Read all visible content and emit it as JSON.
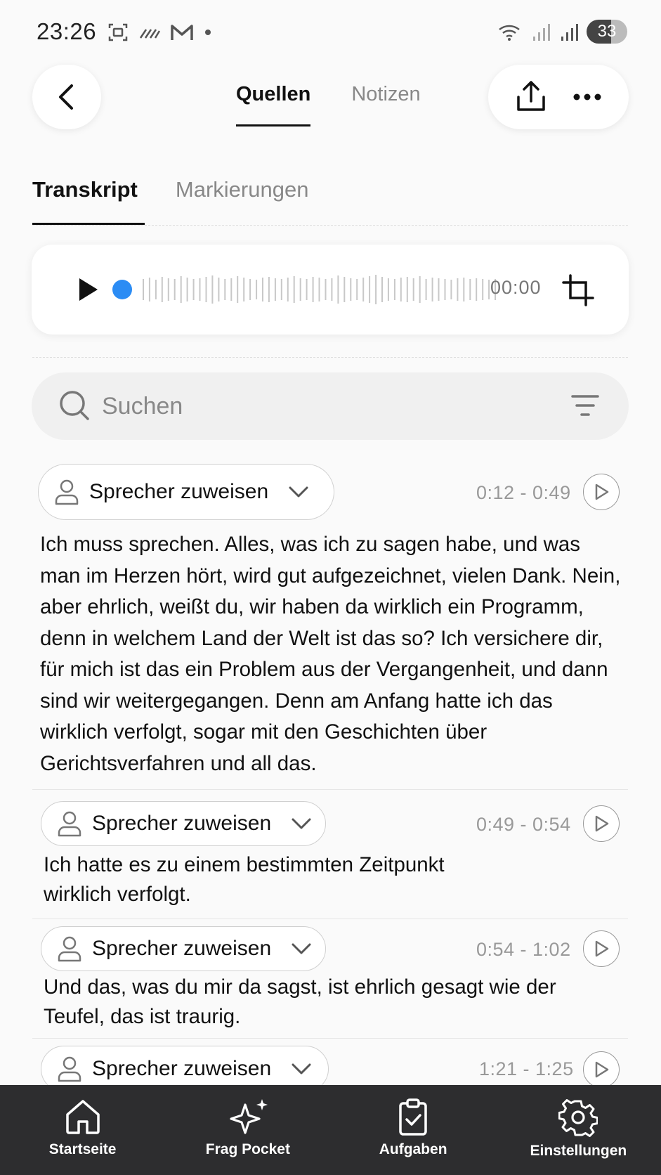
{
  "status_bar": {
    "time": "23:26",
    "battery": "33"
  },
  "header": {
    "tabs": [
      {
        "label": "Quellen",
        "active": true
      },
      {
        "label": "Notizen",
        "active": false
      }
    ],
    "back_icon": "chevron-left-icon",
    "share_icon": "share-icon",
    "more_icon": "more-horizontal-icon"
  },
  "sub_tabs": [
    {
      "label": "Transkript",
      "active": true
    },
    {
      "label": "Markierungen",
      "active": false
    }
  ],
  "player": {
    "time": "00:00",
    "progress": 0,
    "accent": "#2b8cf4"
  },
  "search": {
    "placeholder": "Suchen"
  },
  "segments": [
    {
      "speaker_label": "Sprecher zuweisen",
      "range": "0:12 - 0:49",
      "text": "Ich muss sprechen. Alles, was ich zu sagen habe, und was man im Herzen hört, wird gut aufgezeichnet, vielen Dank. Nein, aber ehrlich, weißt du, wir haben da wirklich ein Programm, denn in welchem Land der Welt ist das so? Ich versichere dir, für mich ist das ein Problem aus der Vergangenheit, und dann sind wir weitergegangen. Denn am Anfang hatte ich das wirklich verfolgt, sogar mit den Geschichten über Gerichtsverfahren und all das."
    },
    {
      "speaker_label": "Sprecher zuweisen",
      "range": "0:49 - 0:54",
      "text": "Ich hatte es zu einem bestimmten Zeitpunkt wirklich verfolgt."
    },
    {
      "speaker_label": "Sprecher zuweisen",
      "range": "0:54 - 1:02",
      "text": "Und das, was du mir da sagst, ist ehrlich gesagt wie der Teufel, das ist traurig."
    },
    {
      "speaker_label": "Sprecher zuweisen",
      "range": "1:21 - 1:25",
      "text": ""
    }
  ],
  "bottom_nav": [
    {
      "label": "Startseite",
      "icon": "home-icon"
    },
    {
      "label": "Frag Pocket",
      "icon": "sparkle-icon"
    },
    {
      "label": "Aufgaben",
      "icon": "clipboard-check-icon"
    },
    {
      "label": "Einstellungen",
      "icon": "gear-icon"
    }
  ]
}
